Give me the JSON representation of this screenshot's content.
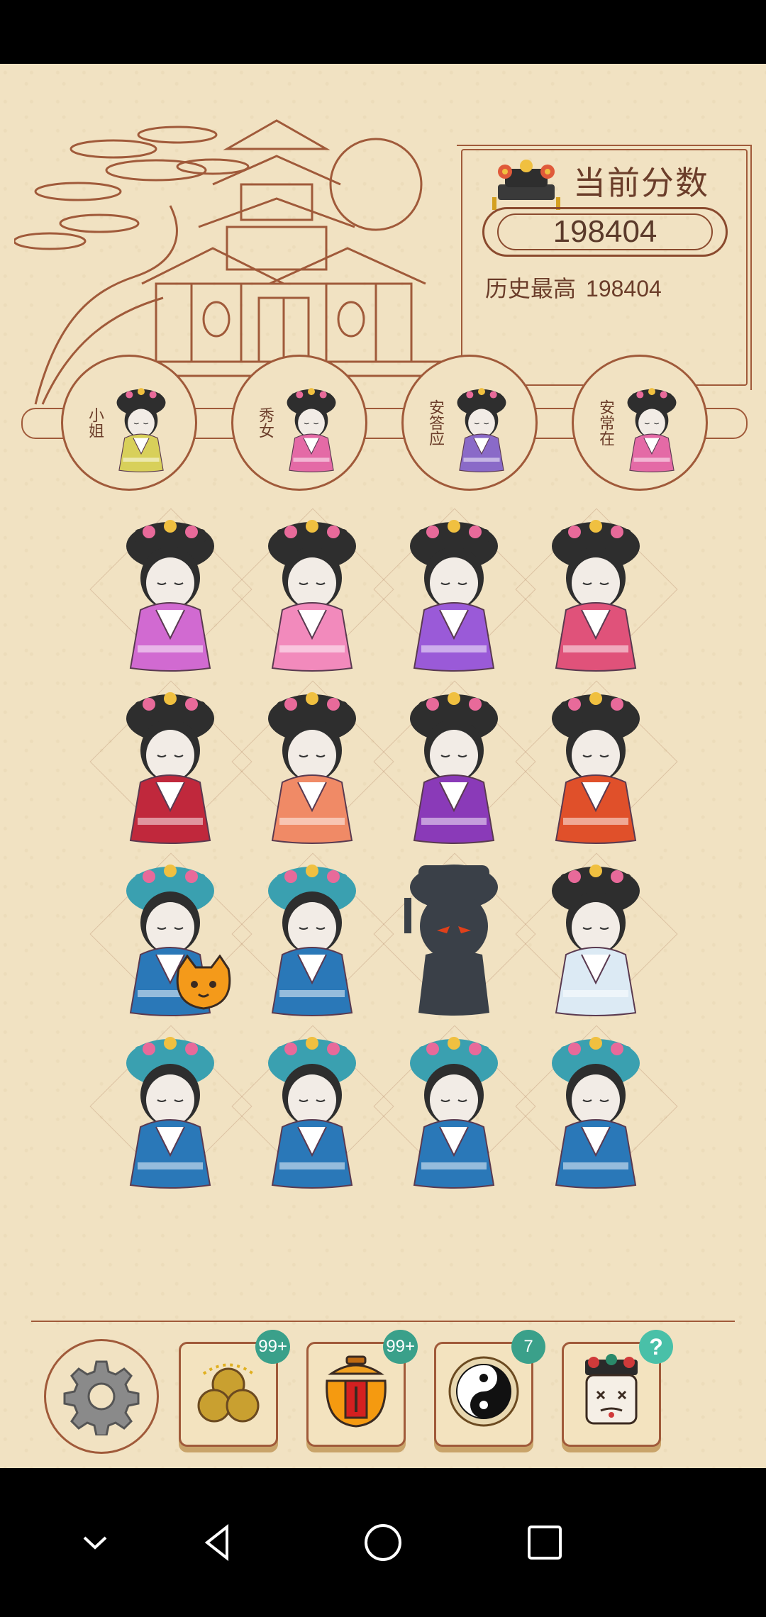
{
  "score_panel": {
    "label": "当前分数",
    "current_score": "198404",
    "best_label": "历史最高",
    "best_score": "198404"
  },
  "slots": [
    {
      "label": "小姐",
      "dress": "#d8d05a"
    },
    {
      "label": "秀女",
      "dress": "#e46aa6"
    },
    {
      "label": "安答应",
      "dress": "#8a6ac8"
    },
    {
      "label": "安常在",
      "dress": "#e46aa6"
    }
  ],
  "board": [
    [
      {
        "kind": "doll",
        "dress": "#d16ad1",
        "hair": "#2e2e2e"
      },
      {
        "kind": "doll",
        "dress": "#f28abc",
        "hair": "#2e2e2e"
      },
      {
        "kind": "doll",
        "dress": "#9a5ad8",
        "hair": "#2e2e2e"
      },
      {
        "kind": "doll",
        "dress": "#e0527a",
        "hair": "#2e2e2e"
      }
    ],
    [
      {
        "kind": "doll",
        "dress": "#c0283c",
        "hair": "#2e2e2e"
      },
      {
        "kind": "doll",
        "dress": "#f08a66",
        "hair": "#2e2e2e"
      },
      {
        "kind": "doll",
        "dress": "#8a3ab8",
        "hair": "#2e2e2e"
      },
      {
        "kind": "doll",
        "dress": "#e0502a",
        "hair": "#2e2e2e"
      }
    ],
    [
      {
        "kind": "doll",
        "dress": "#2a78b8",
        "hair": "#3aa0b0",
        "cat": true
      },
      {
        "kind": "doll",
        "dress": "#2a78b8",
        "hair": "#3aa0b0"
      },
      {
        "kind": "shadow"
      },
      {
        "kind": "doll",
        "dress": "#dceaf4",
        "hair": "#2e2e2e"
      }
    ],
    [
      {
        "kind": "doll",
        "dress": "#2a78b8",
        "hair": "#3aa0b0"
      },
      {
        "kind": "doll",
        "dress": "#2a78b8",
        "hair": "#3aa0b0"
      },
      {
        "kind": "doll",
        "dress": "#2a78b8",
        "hair": "#3aa0b0"
      },
      {
        "kind": "doll",
        "dress": "#2a78b8",
        "hair": "#3aa0b0"
      }
    ]
  ],
  "toolbar": {
    "settings_icon": "gear-icon",
    "coins_badge": "99+",
    "jar_badge": "99+",
    "yinyang_badge": "7",
    "help_badge": "?"
  },
  "colors": {
    "parchment": "#f1e2c2",
    "line": "#a05a3a",
    "badge": "#3aa08a"
  }
}
